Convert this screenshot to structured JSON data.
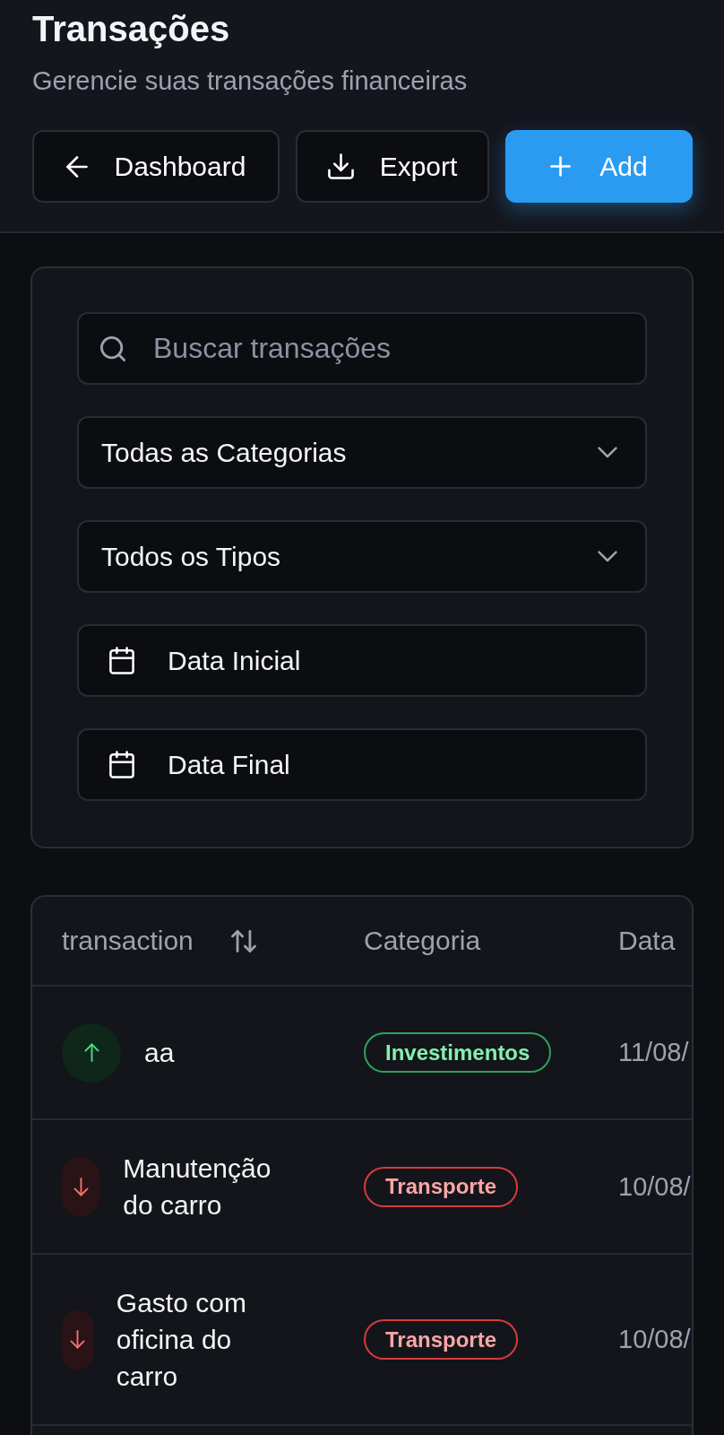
{
  "header": {
    "title": "Transações",
    "subtitle": "Gerencie suas transações financeiras",
    "buttons": [
      {
        "kind": "back",
        "label": "Dashboard"
      },
      {
        "kind": "export",
        "label": "Export"
      },
      {
        "kind": "add",
        "label": "Add"
      }
    ]
  },
  "filters": {
    "search": {
      "placeholder": "Buscar transações"
    },
    "selects": [
      {
        "value": "Todas as Categorias"
      },
      {
        "value": "Todos os Tipos"
      }
    ],
    "date_pickers": [
      {
        "label": "Data Inicial"
      },
      {
        "label": "Data Final"
      }
    ]
  },
  "table": {
    "columns": [
      {
        "label": "transaction",
        "sortable": true
      },
      {
        "label": "Categoria",
        "sortable": false
      },
      {
        "label": "Data",
        "sortable": false
      }
    ],
    "rows": [
      {
        "kind": "income",
        "description": "aa",
        "category": "Investimentos",
        "date": "11/08/"
      },
      {
        "kind": "expense",
        "description": "Manutenção do carro",
        "category": "Transporte",
        "date": "10/08/"
      },
      {
        "kind": "expense",
        "description": "Gasto com oficina do carro",
        "category": "Transporte",
        "date": "10/08/"
      }
    ]
  }
}
